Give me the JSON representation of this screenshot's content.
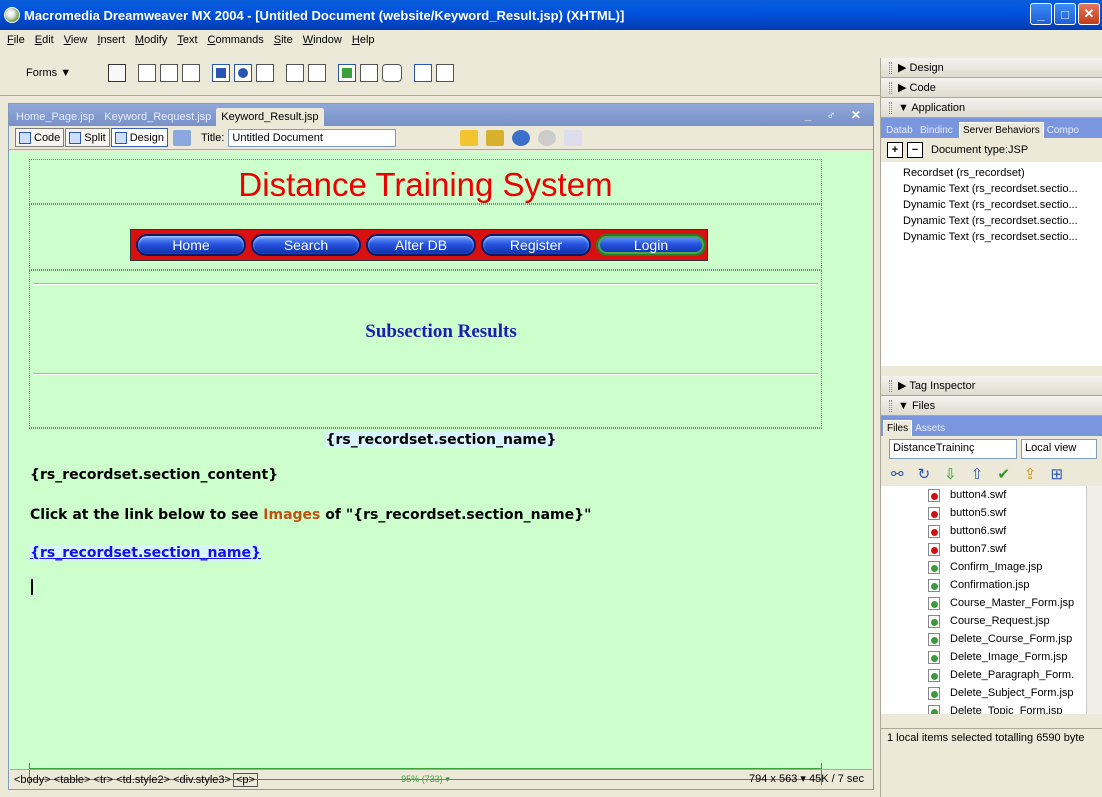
{
  "window": {
    "title": "Macromedia Dreamweaver MX 2004 - [Untitled Document (website/Keyword_Result.jsp) (XHTML)]",
    "controls": {
      "minimize": "_",
      "maximize": "□",
      "close": "✕"
    }
  },
  "menu": [
    "File",
    "Edit",
    "View",
    "Insert",
    "Modify",
    "Text",
    "Commands",
    "Site",
    "Window",
    "Help"
  ],
  "insert_bar": {
    "category": "Forms ▼"
  },
  "document": {
    "tabs": [
      "Home_Page.jsp",
      "Keyword_Request.jsp",
      "Keyword_Result.jsp"
    ],
    "active_tab": "Keyword_Result.jsp",
    "window_controls": "_ ♂ ✕",
    "toolbar": {
      "code_label": "Code",
      "split_label": "Split",
      "design_label": "Design",
      "title_label": "Title:",
      "title_value": "Untitled Document"
    },
    "page": {
      "site_title": "Distance Training System",
      "nav": [
        "Home",
        "Search",
        "Alter DB",
        "Register",
        "Login"
      ],
      "subsection_heading": "Subsection Results",
      "section_name": "{rs_recordset.section_name}",
      "section_content": "{rs_recordset.section_content}",
      "link_prefix": "Click at the link below to see ",
      "link_images_word": "Images",
      "link_suffix": " of \"{rs_recordset.section_name}\"",
      "section_link": "{rs_recordset.section_name}",
      "ruler_label": "95% (733) ▾"
    },
    "status": {
      "tags": [
        "<body>",
        "<table>",
        "<tr>",
        "<td.style2>",
        "<div.style3>"
      ],
      "selected_tag": "<p>",
      "dimensions": "794 x 563 ▾ 45K / 7 sec"
    }
  },
  "panels": {
    "design": "▶ Design",
    "code": "▶ Code",
    "application": "▼ Application",
    "app_tabs": [
      "Datab",
      "Bindinc",
      "Server Behaviors",
      "Compo"
    ],
    "active_app_tab": "Server Behaviors",
    "doc_type": "Document type:JSP",
    "server_behaviors": [
      "Recordset (rs_recordset)",
      "Dynamic Text (rs_recordset.sectio...",
      "Dynamic Text (rs_recordset.sectio...",
      "Dynamic Text (rs_recordset.sectio...",
      "Dynamic Text (rs_recordset.sectio..."
    ],
    "tag_inspector": "▶ Tag Inspector",
    "files": "▼ Files",
    "files_tabs": [
      "Files",
      "Assets"
    ],
    "site_select": "DistanceTraininç",
    "view_select": "Local view",
    "file_items": [
      {
        "name": "button4.swf",
        "type": "swf"
      },
      {
        "name": "button5.swf",
        "type": "swf"
      },
      {
        "name": "button6.swf",
        "type": "swf"
      },
      {
        "name": "button7.swf",
        "type": "swf"
      },
      {
        "name": "Confirm_Image.jsp",
        "type": "jsp"
      },
      {
        "name": "Confirmation.jsp",
        "type": "jsp"
      },
      {
        "name": "Course_Master_Form.jsp",
        "type": "jsp"
      },
      {
        "name": "Course_Request.jsp",
        "type": "jsp"
      },
      {
        "name": "Delete_Course_Form.jsp",
        "type": "jsp"
      },
      {
        "name": "Delete_Image_Form.jsp",
        "type": "jsp"
      },
      {
        "name": "Delete_Paragraph_Form.",
        "type": "jsp"
      },
      {
        "name": "Delete_Subject_Form.jsp",
        "type": "jsp"
      },
      {
        "name": "Delete_Topic_Form.jsp",
        "type": "jsp"
      }
    ],
    "files_status": "1 local items selected totalling 6590 byte"
  }
}
